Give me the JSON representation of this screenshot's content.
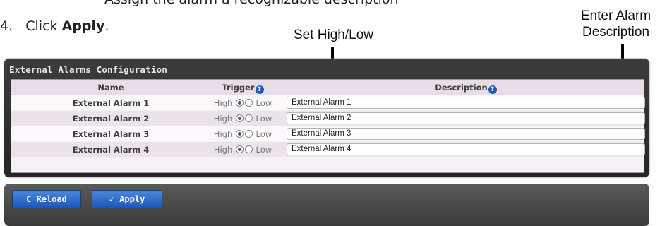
{
  "doc": {
    "partial_line": "Assign the alarm a recognizable description",
    "step_number": "4.",
    "step_prefix": "Click ",
    "step_action": "Apply",
    "step_suffix": "."
  },
  "callouts": {
    "set_high_low": "Set High/Low",
    "enter_desc_line1": "Enter Alarm",
    "enter_desc_line2": "Description"
  },
  "panel": {
    "title": "External Alarms Configuration",
    "columns": {
      "name": "Name",
      "trigger": "Trigger",
      "description": "Description"
    },
    "help_icon": "?",
    "trigger_high": "High",
    "trigger_low": "Low",
    "rows": [
      {
        "name": "External Alarm 1",
        "trigger": "High",
        "description": "External Alarm 1"
      },
      {
        "name": "External Alarm 2",
        "trigger": "High",
        "description": "External Alarm 2"
      },
      {
        "name": "External Alarm 3",
        "trigger": "High",
        "description": "External Alarm 3"
      },
      {
        "name": "External Alarm 4",
        "trigger": "High",
        "description": "External Alarm 4"
      }
    ]
  },
  "buttons": {
    "reload_icon": "C",
    "reload_label": "Reload",
    "apply_icon": "✓",
    "apply_label": "Apply"
  }
}
